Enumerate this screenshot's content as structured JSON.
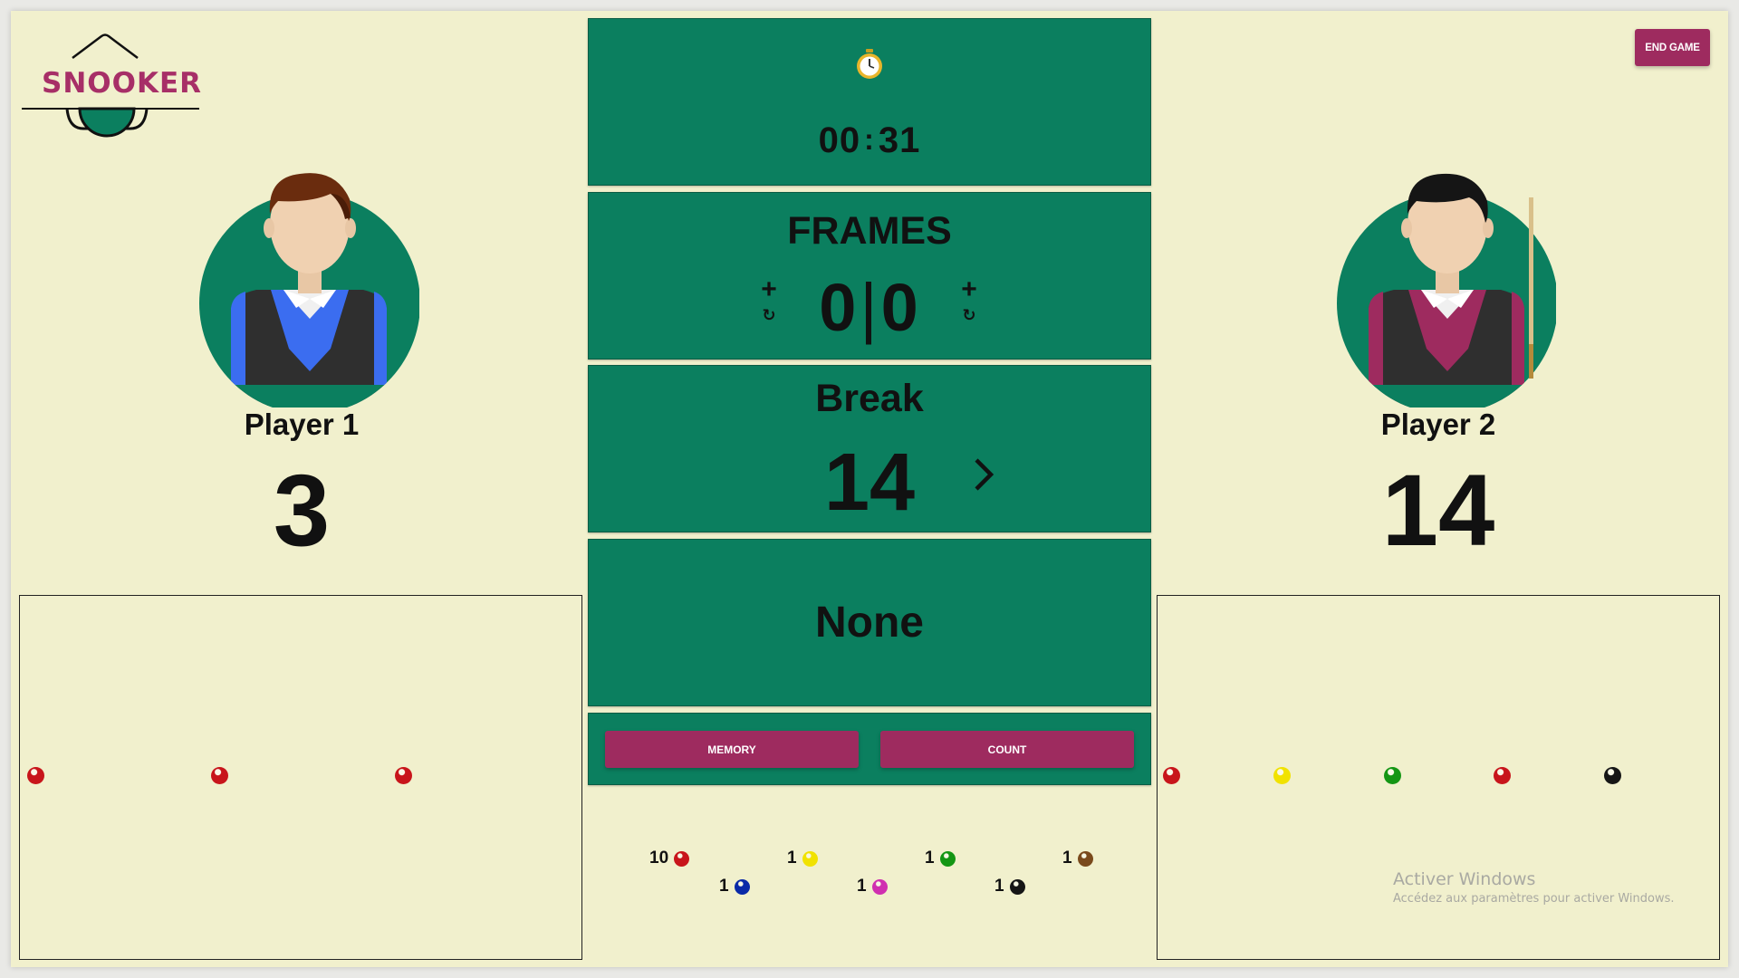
{
  "app": {
    "logo_text": "SNOOKER",
    "end_game_label": "END GAME",
    "brand_color": "#9e2b5f",
    "felt_color": "#0b7f5f",
    "background_color": "#f1f0cd"
  },
  "players": [
    {
      "name": "Player 1",
      "score": "3",
      "vest_color": "#3b6df0",
      "potted": [
        "red",
        "red",
        "red"
      ]
    },
    {
      "name": "Player 2",
      "score": "14",
      "vest_color": "#9e2b5f",
      "potted": [
        "red",
        "yellow",
        "green",
        "red",
        "black"
      ]
    }
  ],
  "timer": {
    "icon": "stopwatch-icon",
    "minutes": "00",
    "separator": ":",
    "seconds": "31"
  },
  "frames": {
    "title": "FRAMES",
    "player1": "0",
    "separator": "|",
    "player2": "0",
    "add_symbol": "+",
    "reset_symbol": "↻"
  },
  "break": {
    "title": "Break",
    "value": "14",
    "next_symbol": "›"
  },
  "status": {
    "value": "None"
  },
  "actions": {
    "memory_label": "MEMORY",
    "count_label": "COUNT"
  },
  "remaining_balls": [
    {
      "count": "10",
      "color": "red"
    },
    {
      "count": "1",
      "color": "yellow"
    },
    {
      "count": "1",
      "color": "green"
    },
    {
      "count": "1",
      "color": "brown"
    },
    {
      "count": "1",
      "color": "blue"
    },
    {
      "count": "1",
      "color": "pink"
    },
    {
      "count": "1",
      "color": "black"
    }
  ],
  "ball_colors": {
    "red": "#c8151b",
    "yellow": "#f1e200",
    "green": "#149614",
    "brown": "#7a4a1c",
    "blue": "#0a2aa8",
    "pink": "#d02fb0",
    "black": "#161616"
  },
  "watermark": {
    "line1": "Activer Windows",
    "line2": "Accédez aux paramètres pour activer Windows."
  }
}
